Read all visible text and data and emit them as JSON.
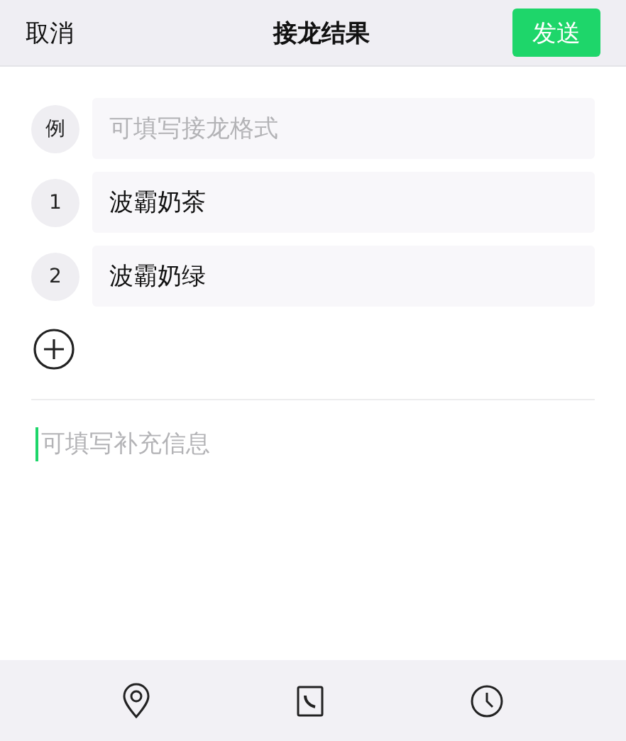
{
  "header": {
    "cancel": "取消",
    "title": "接龙结果",
    "send": "发送"
  },
  "example": {
    "marker": "例",
    "placeholder": "可填写接龙格式"
  },
  "entries": [
    {
      "number": "1",
      "value": "波霸奶茶"
    },
    {
      "number": "2",
      "value": "波霸奶绿"
    }
  ],
  "notes": {
    "placeholder": "可填写补充信息",
    "focused": true
  }
}
